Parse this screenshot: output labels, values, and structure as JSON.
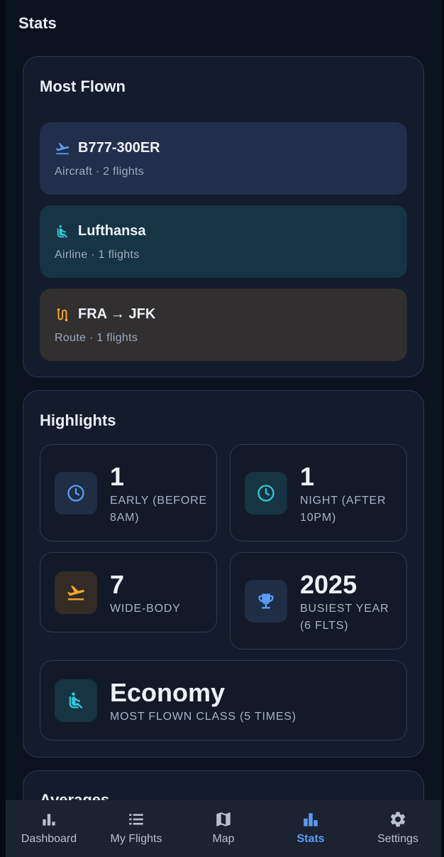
{
  "page_title": "Stats",
  "most_flown": {
    "title": "Most Flown",
    "items": [
      {
        "icon": "plane-takeoff-icon",
        "name": "B777-300ER",
        "sub": "Aircraft · 2 flights"
      },
      {
        "icon": "seat-icon",
        "name": "Lufthansa",
        "sub": "Airline · 1 flights"
      },
      {
        "icon": "route-icon",
        "name": "FRA → JFK",
        "sub": "Route · 1 flights"
      }
    ]
  },
  "highlights": {
    "title": "Highlights",
    "early": {
      "value": "1",
      "label_1": "EARLY (BEFORE",
      "label_2": "8AM)"
    },
    "night": {
      "value": "1",
      "label_1": "NIGHT (AFTER",
      "label_2": "10PM)"
    },
    "widebody": {
      "value": "7",
      "label_1": "WIDE-BODY"
    },
    "busiest": {
      "value": "2025",
      "label_1": "BUSIEST YEAR",
      "label_2": "(6 FLTS)"
    },
    "class": {
      "value": "Economy",
      "label_1": "MOST FLOWN CLASS (5 TIMES)"
    }
  },
  "averages": {
    "title": "Averages"
  },
  "nav": {
    "dashboard": "Dashboard",
    "my_flights": "My Flights",
    "map": "Map",
    "stats": "Stats",
    "settings": "Settings",
    "active": "stats"
  },
  "colors": {
    "accent_blue": "#5b9cf2",
    "accent_teal": "#2ec7d9",
    "accent_orange": "#f2a52b",
    "aircraft_bg": "#212f4b",
    "airline_bg": "#173444",
    "route_bg": "#312f2f"
  }
}
